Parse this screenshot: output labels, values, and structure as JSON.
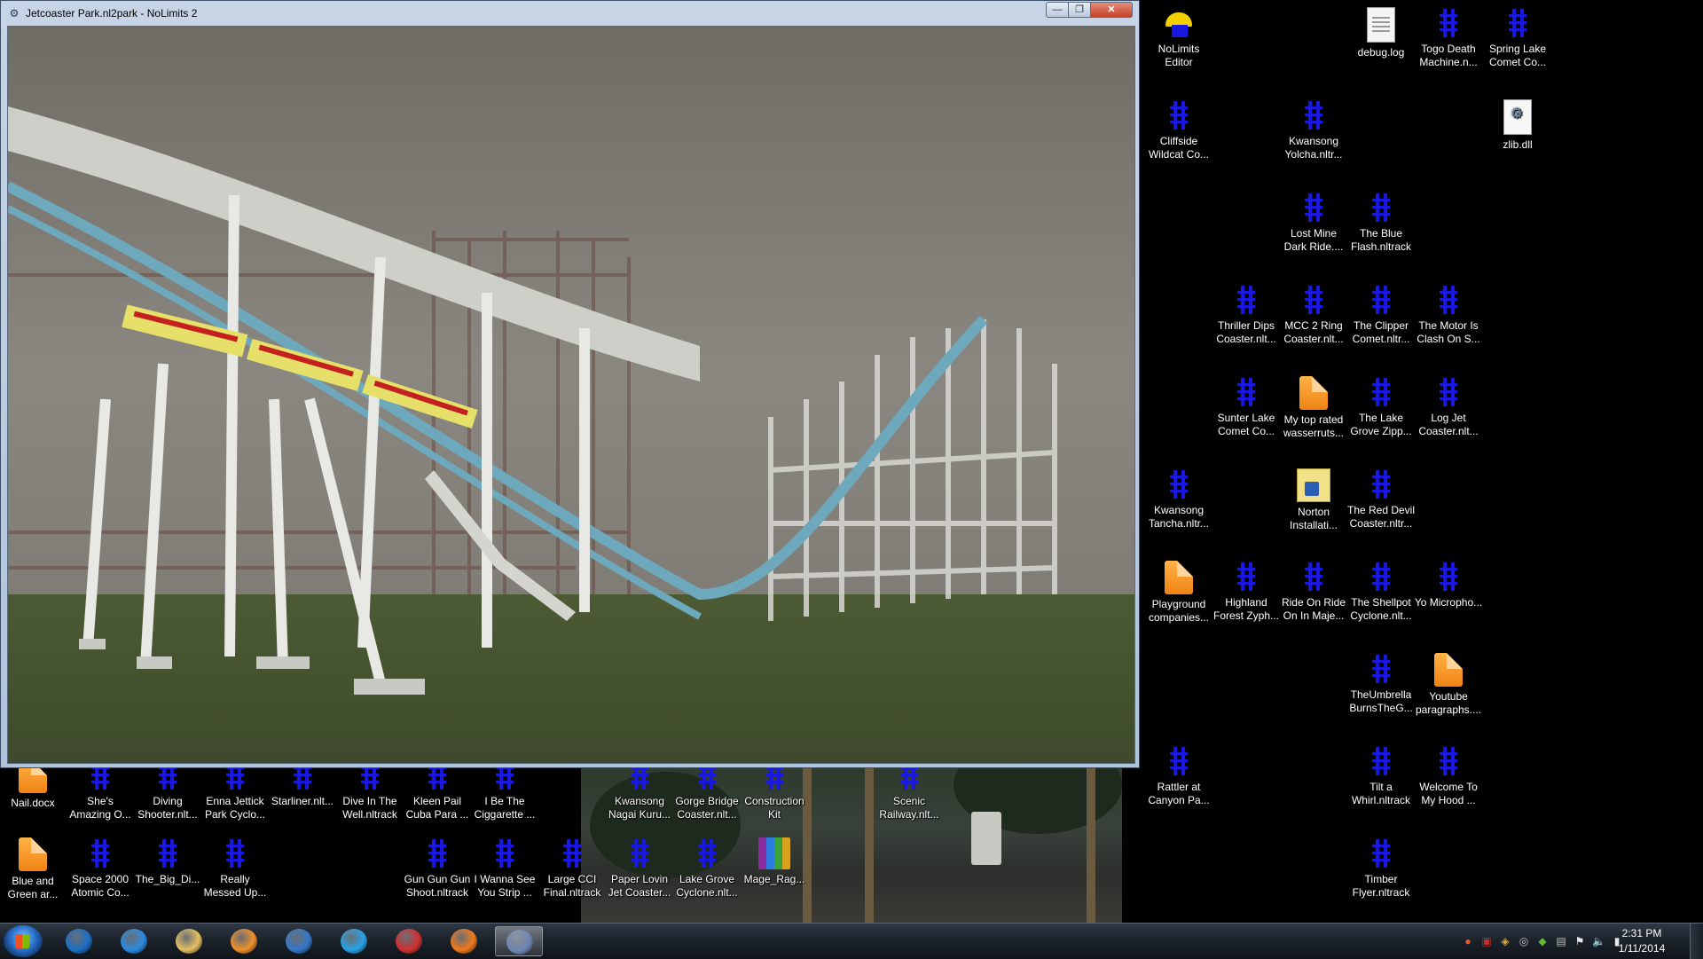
{
  "window": {
    "title": "Jetcoaster Park.nl2park - NoLimits 2",
    "min_glyph": "—",
    "max_glyph": "❐",
    "close_glyph": "✕",
    "icon": "nolimits-app-icon"
  },
  "desktop_icons": [
    {
      "id": "nolimits-editor",
      "label": "NoLimits Editor",
      "icon": "editor"
    },
    {
      "id": "debug-log",
      "label": "debug.log",
      "icon": "txt"
    },
    {
      "id": "togo-death",
      "label": "Togo Death Machine.n...",
      "icon": "nl"
    },
    {
      "id": "spring-lake",
      "label": "Spring Lake Comet Co...",
      "icon": "nl"
    },
    {
      "id": "cliffside",
      "label": "Cliffside Wildcat Co...",
      "icon": "nl"
    },
    {
      "id": "kwansong-yolcha",
      "label": "Kwansong Yolcha.nltr...",
      "icon": "nl"
    },
    {
      "id": "zlib",
      "label": "zlib.dll",
      "icon": "dll"
    },
    {
      "id": "lost-mine",
      "label": "Lost Mine Dark Ride....",
      "icon": "nl"
    },
    {
      "id": "blue-flash",
      "label": "The Blue Flash.nltrack",
      "icon": "nl"
    },
    {
      "id": "thriller-dips",
      "label": "Thriller Dips Coaster.nlt...",
      "icon": "nl"
    },
    {
      "id": "mcc2",
      "label": "MCC 2 Ring Coaster.nlt...",
      "icon": "nl"
    },
    {
      "id": "clipper",
      "label": "The Clipper Comet.nltr...",
      "icon": "nl"
    },
    {
      "id": "motor-clash",
      "label": "The Motor Is Clash On S...",
      "icon": "nl"
    },
    {
      "id": "sunter-lake",
      "label": "Sunter Lake Comet Co...",
      "icon": "nl"
    },
    {
      "id": "top-rated",
      "label": "My top rated wasserruts...",
      "icon": "doc"
    },
    {
      "id": "lake-grove-zipp",
      "label": "The Lake Grove Zipp...",
      "icon": "nl"
    },
    {
      "id": "log-jet",
      "label": "Log Jet Coaster.nlt...",
      "icon": "nl"
    },
    {
      "id": "kwansong-tancha",
      "label": "Kwansong Tancha.nltr...",
      "icon": "nl"
    },
    {
      "id": "norton",
      "label": "Norton Installati...",
      "icon": "norton"
    },
    {
      "id": "red-devil",
      "label": "The Red Devil Coaster.nltr...",
      "icon": "nl"
    },
    {
      "id": "playground",
      "label": "Playground companies...",
      "icon": "doc"
    },
    {
      "id": "highland",
      "label": "Highland Forest Zyph...",
      "icon": "nl"
    },
    {
      "id": "ride-on",
      "label": "Ride On Ride On In Maje...",
      "icon": "nl"
    },
    {
      "id": "shellpot",
      "label": "The Shellpot Cyclone.nlt...",
      "icon": "nl"
    },
    {
      "id": "yo-micro",
      "label": "Yo Micropho...",
      "icon": "nl"
    },
    {
      "id": "umbrella",
      "label": "TheUmbrella BurnsTheG...",
      "icon": "nl"
    },
    {
      "id": "youtube",
      "label": "Youtube paragraphs....",
      "icon": "doc"
    },
    {
      "id": "rattler",
      "label": "Rattler at Canyon Pa...",
      "icon": "nl"
    },
    {
      "id": "tilt",
      "label": "Tilt a Whirl.nltrack",
      "icon": "nl"
    },
    {
      "id": "welcome",
      "label": "Welcome To My Hood ...",
      "icon": "nl"
    },
    {
      "id": "timber",
      "label": "Timber Flyer.nltrack",
      "icon": "nl"
    },
    {
      "id": "nail",
      "label": "Nail.docx",
      "icon": "doc"
    },
    {
      "id": "shes-amazing",
      "label": "She's Amazing O...",
      "icon": "nl"
    },
    {
      "id": "diving",
      "label": "Diving Shooter.nlt...",
      "icon": "nl"
    },
    {
      "id": "enna",
      "label": "Enna Jettick Park Cyclo...",
      "icon": "nl"
    },
    {
      "id": "starliner",
      "label": "Starliner.nlt...",
      "icon": "nl"
    },
    {
      "id": "dive-well",
      "label": "Dive In The Well.nltrack",
      "icon": "nl"
    },
    {
      "id": "kleen-pail",
      "label": "Kleen Pail Cuba Para ...",
      "icon": "nl"
    },
    {
      "id": "cigarette",
      "label": "I Be The Ciggarette ...",
      "icon": "nl"
    },
    {
      "id": "kwansong-nagai",
      "label": "Kwansong Nagai Kuru...",
      "icon": "nl"
    },
    {
      "id": "gorge",
      "label": "Gorge Bridge Coaster.nlt...",
      "icon": "nl"
    },
    {
      "id": "construction",
      "label": "Construction Kit",
      "icon": "nl"
    },
    {
      "id": "scenic",
      "label": "Scenic Railway.nlt...",
      "icon": "nl"
    },
    {
      "id": "blue-green",
      "label": "Blue and Green ar...",
      "icon": "doc"
    },
    {
      "id": "space2000",
      "label": "Space 2000 Atomic Co...",
      "icon": "nl"
    },
    {
      "id": "big-di",
      "label": "The_Big_Di...",
      "icon": "nl"
    },
    {
      "id": "really-messed",
      "label": "Really Messed Up...",
      "icon": "nl"
    },
    {
      "id": "gun-gun",
      "label": "Gun Gun Gun Shoot.nltrack",
      "icon": "nl"
    },
    {
      "id": "wanna-see",
      "label": "I Wanna See You Strip ...",
      "icon": "nl"
    },
    {
      "id": "large-cci",
      "label": "Large CCI Final.nltrack",
      "icon": "nl"
    },
    {
      "id": "paper-lovin",
      "label": "Paper Lovin Jet Coaster...",
      "icon": "nl"
    },
    {
      "id": "lake-grove-cyc",
      "label": "Lake Grove Cyclone.nlt...",
      "icon": "nl"
    },
    {
      "id": "mage",
      "label": "Mage_Rag...",
      "icon": "rar"
    }
  ],
  "taskbar": {
    "items": [
      {
        "name": "hp-icon",
        "color": "#1b6fc7"
      },
      {
        "name": "internet-explorer-icon",
        "color": "#2a8be0"
      },
      {
        "name": "file-explorer-icon",
        "color": "#e5c062"
      },
      {
        "name": "media-player-icon",
        "color": "#f0902a"
      },
      {
        "name": "check-app-icon",
        "color": "#3478c8"
      },
      {
        "name": "globe-app-icon",
        "color": "#27a3e8"
      },
      {
        "name": "shield-app-icon",
        "color": "#d03030"
      },
      {
        "name": "firefox-icon",
        "color": "#f07a1a"
      },
      {
        "name": "nolimits-taskbar-icon",
        "color": "#6f86b5"
      }
    ],
    "active_index": 8,
    "clock_time": "2:31 PM",
    "clock_date": "1/11/2014"
  },
  "tray": [
    "red-app-icon",
    "security-icon",
    "network-app-icon",
    "steam-icon",
    "nvidia-icon",
    "wifi-icon",
    "flag-icon",
    "volume-icon",
    "signal-icon"
  ]
}
